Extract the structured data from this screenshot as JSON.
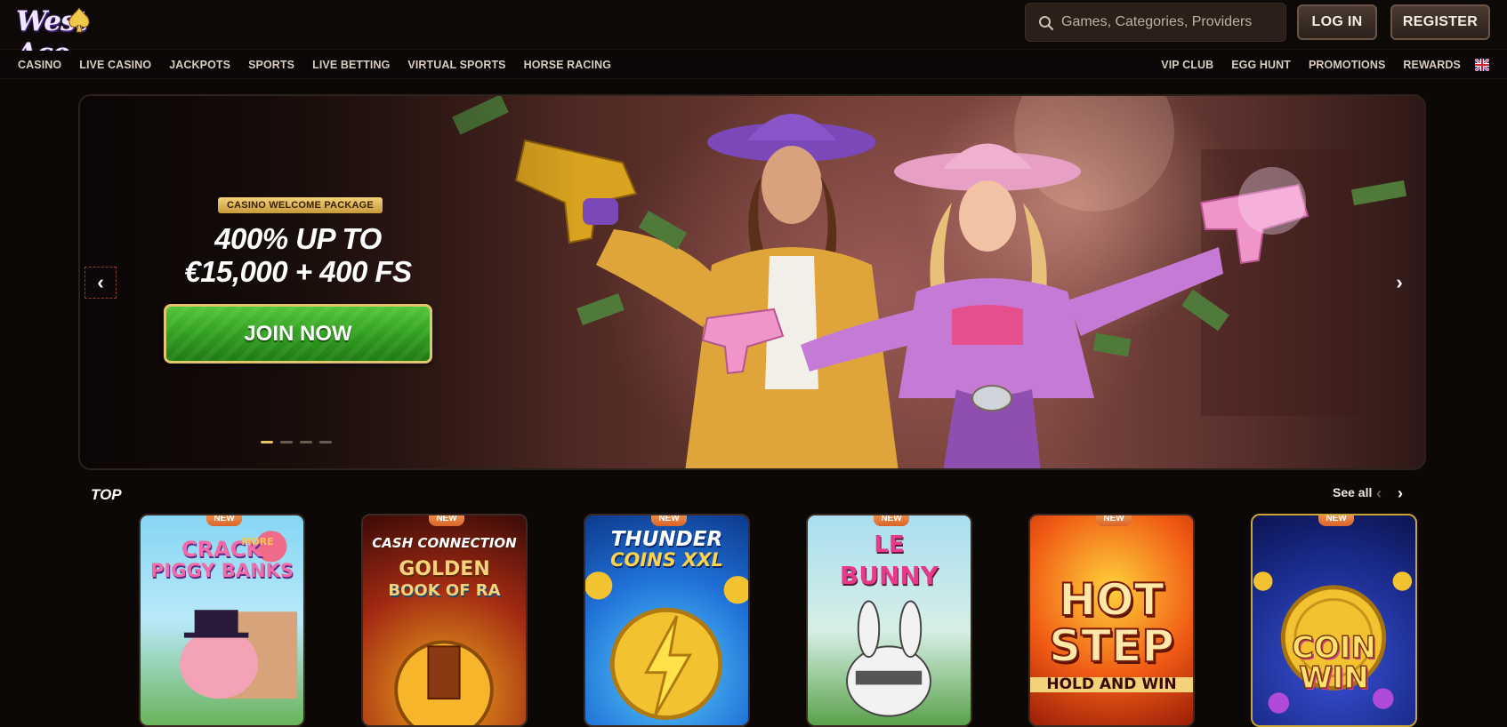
{
  "brand": {
    "logo_text_1": "West",
    "logo_text_2": "Ace"
  },
  "search": {
    "placeholder": "Games, Categories, Providers"
  },
  "header": {
    "login_label": "LOG IN",
    "register_label": "REGISTER"
  },
  "nav": {
    "left": [
      "CASINO",
      "LIVE CASINO",
      "JACKPOTS",
      "SPORTS",
      "LIVE BETTING",
      "VIRTUAL SPORTS",
      "HORSE RACING"
    ],
    "right": [
      "VIP CLUB",
      "EGG HUNT",
      "PROMOTIONS",
      "REWARDS"
    ],
    "language_icon": "uk-flag-icon"
  },
  "hero": {
    "badge": "CASINO WELCOME PACKAGE",
    "title_line1": "400% UP TO",
    "title_line2": "€15,000 + 400 FS",
    "cta": "JOIN NOW",
    "slides_total": 4,
    "active_slide": 1,
    "prev_icon": "chevron-left-icon",
    "next_icon": "chevron-right-icon"
  },
  "top_section": {
    "title": "TOP",
    "see_all": "See all",
    "games": [
      {
        "badge": "NEW",
        "title_lines": [
          "CRACK",
          "MORE",
          "PIGGY BANKS"
        ],
        "bg": "#7fd0f0"
      },
      {
        "badge": "NEW",
        "title_lines": [
          "CASH CONNECTION",
          "GOLDEN",
          "BOOK OF RA"
        ],
        "bg": "#6a1d12"
      },
      {
        "badge": "NEW",
        "title_lines": [
          "THUNDER",
          "COINS XXL"
        ],
        "bg": "#2a8ee0"
      },
      {
        "badge": "NEW",
        "title_lines": [
          "LE",
          "BUNNY"
        ],
        "bg": "#8fcfe4"
      },
      {
        "badge": "NEW",
        "title_lines": [
          "HOT",
          "STEP",
          "HOLD AND WIN"
        ],
        "bg": "#e2561a"
      },
      {
        "badge": "NEW",
        "title_lines": [
          "COIN",
          "WIN"
        ],
        "bg": "#1a2b8c"
      }
    ]
  },
  "colors": {
    "accent_gold": "#e6c35a",
    "cta_green": "#3fae29",
    "bg": "#0c0806"
  }
}
